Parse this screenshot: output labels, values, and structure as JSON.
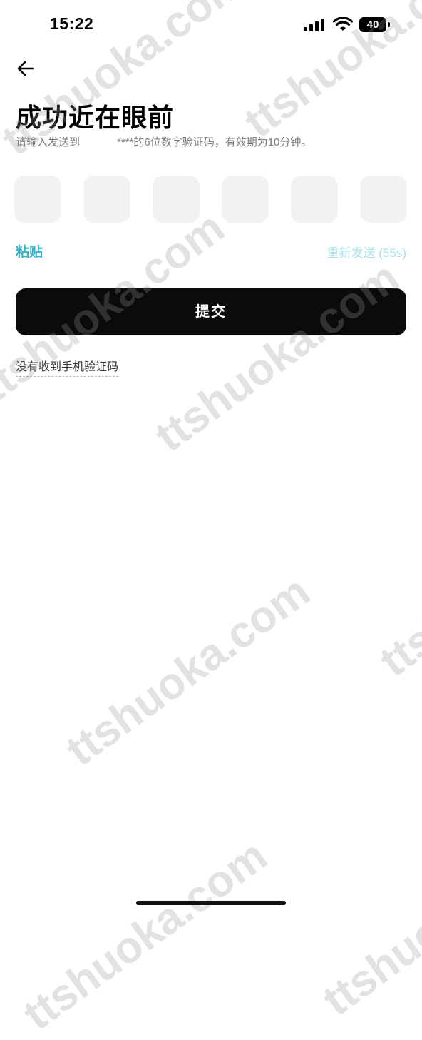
{
  "status_bar": {
    "time": "15:22",
    "battery": "40"
  },
  "header": {
    "title": "成功近在眼前"
  },
  "instruction": {
    "prefix": "请输入发送到",
    "masked_number": "****",
    "suffix": "的6位数字验证码，有效期为10分钟。"
  },
  "code_inputs": {
    "count": 6,
    "values": [
      "",
      "",
      "",
      "",
      "",
      ""
    ]
  },
  "actions": {
    "paste_label": "粘贴",
    "resend_label": "重新发送 (55s)",
    "submit_label": "提交",
    "no_code_label": "没有收到手机验证码"
  },
  "watermark": {
    "text": "ttshuoka.com"
  },
  "colors": {
    "accent": "#35b0c6",
    "accent_disabled": "#a9e1ea",
    "button_bg": "#0b0b0b",
    "input_bg": "#f2f2f3"
  }
}
